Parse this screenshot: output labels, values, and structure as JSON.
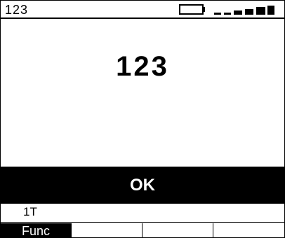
{
  "status": {
    "title": "123",
    "battery_icon": "battery-empty-icon",
    "signal_icon": "signal-strength-icon",
    "signal_level": 4
  },
  "display": {
    "value": "123"
  },
  "actions": {
    "ok_label": "OK"
  },
  "mode": {
    "label": "1T"
  },
  "function_keys": [
    "Func",
    "",
    "",
    ""
  ]
}
